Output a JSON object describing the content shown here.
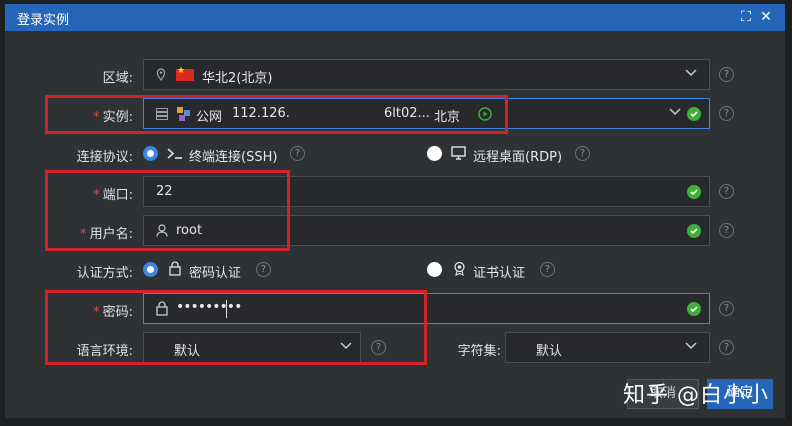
{
  "window": {
    "title": "登录实例",
    "maximize_glyph": "⛶",
    "close_glyph": "✕"
  },
  "form": {
    "region": {
      "label": "区域:",
      "value": "华北2(北京)"
    },
    "instance": {
      "label": "实例:",
      "type": "公网",
      "ip": "112.126.",
      "id": "6lt02...",
      "city": "北京"
    },
    "protocol": {
      "label": "连接协议:",
      "ssh": "终端连接(SSH)",
      "rdp": "远程桌面(RDP)"
    },
    "port": {
      "label": "端口:",
      "value": "22"
    },
    "username": {
      "label": "用户名:",
      "value": "root"
    },
    "auth": {
      "label": "认证方式:",
      "password": "密码认证",
      "cert": "证书认证"
    },
    "password": {
      "label": "密码:",
      "masked": "•••••••••"
    },
    "locale": {
      "label": "语言环境:",
      "value": "默认"
    },
    "charset": {
      "label": "字符集:",
      "value": "默认"
    }
  },
  "buttons": {
    "cancel": "取消",
    "confirm": "确定"
  },
  "watermark": "知乎 @白小小",
  "colors": {
    "titlebar": "#2566b8",
    "highlight_box": "#d2232a",
    "success": "#3fae3a",
    "accent": "#3b86e0"
  }
}
